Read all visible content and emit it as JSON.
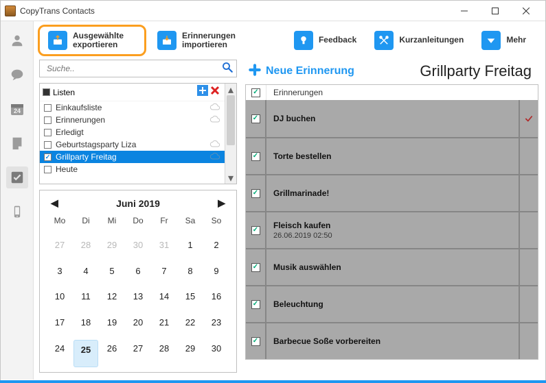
{
  "app": {
    "title": "CopyTrans Contacts"
  },
  "toolbar": {
    "export_label": "Ausgewählte exportieren",
    "import_label": "Erinnerungen importieren",
    "feedback_label": "Feedback",
    "guides_label": "Kurzanleitungen",
    "more_label": "Mehr"
  },
  "search": {
    "placeholder": "Suche.."
  },
  "lists": {
    "header": "Listen",
    "items": [
      {
        "label": "Einkaufsliste",
        "checked": false,
        "cloud": true,
        "selected": false
      },
      {
        "label": "Erinnerungen",
        "checked": false,
        "cloud": true,
        "selected": false
      },
      {
        "label": "Erledigt",
        "checked": false,
        "cloud": false,
        "selected": false
      },
      {
        "label": "Geburtstagsparty Liza",
        "checked": false,
        "cloud": true,
        "selected": false
      },
      {
        "label": "Grillparty Freitag",
        "checked": true,
        "cloud": true,
        "selected": true
      },
      {
        "label": "Heute",
        "checked": false,
        "cloud": false,
        "selected": false
      }
    ]
  },
  "calendar": {
    "month_label": "Juni 2019",
    "dow": [
      "Mo",
      "Di",
      "Mi",
      "Do",
      "Fr",
      "Sa",
      "So"
    ],
    "days": [
      {
        "n": 27,
        "out": true
      },
      {
        "n": 28,
        "out": true
      },
      {
        "n": 29,
        "out": true
      },
      {
        "n": 30,
        "out": true
      },
      {
        "n": 31,
        "out": true
      },
      {
        "n": 1
      },
      {
        "n": 2
      },
      {
        "n": 3
      },
      {
        "n": 4
      },
      {
        "n": 5
      },
      {
        "n": 6
      },
      {
        "n": 7
      },
      {
        "n": 8
      },
      {
        "n": 9
      },
      {
        "n": 10
      },
      {
        "n": 11
      },
      {
        "n": 12
      },
      {
        "n": 13
      },
      {
        "n": 14
      },
      {
        "n": 15
      },
      {
        "n": 16
      },
      {
        "n": 17
      },
      {
        "n": 18
      },
      {
        "n": 19
      },
      {
        "n": 20
      },
      {
        "n": 21
      },
      {
        "n": 22
      },
      {
        "n": 23
      },
      {
        "n": 24
      },
      {
        "n": 25,
        "today": true
      },
      {
        "n": 26
      },
      {
        "n": 27
      },
      {
        "n": 28
      },
      {
        "n": 29
      },
      {
        "n": 30
      }
    ]
  },
  "right": {
    "new_label": "Neue Erinnerung",
    "title": "Grillparty Freitag",
    "column_header": "Erinnerungen",
    "reminders": [
      {
        "title": "DJ buchen",
        "sub": "",
        "checked": true,
        "flag": true
      },
      {
        "title": "Torte bestellen",
        "sub": "",
        "checked": true,
        "flag": false
      },
      {
        "title": "Grillmarinade!",
        "sub": "",
        "checked": true,
        "flag": false
      },
      {
        "title": "Fleisch kaufen",
        "sub": "26.06.2019 02:50",
        "checked": true,
        "flag": false
      },
      {
        "title": "Musik auswählen",
        "sub": "",
        "checked": true,
        "flag": false
      },
      {
        "title": "Beleuchtung",
        "sub": "",
        "checked": true,
        "flag": false
      },
      {
        "title": "Barbecue Soße vorbereiten",
        "sub": "",
        "checked": true,
        "flag": false
      }
    ]
  }
}
